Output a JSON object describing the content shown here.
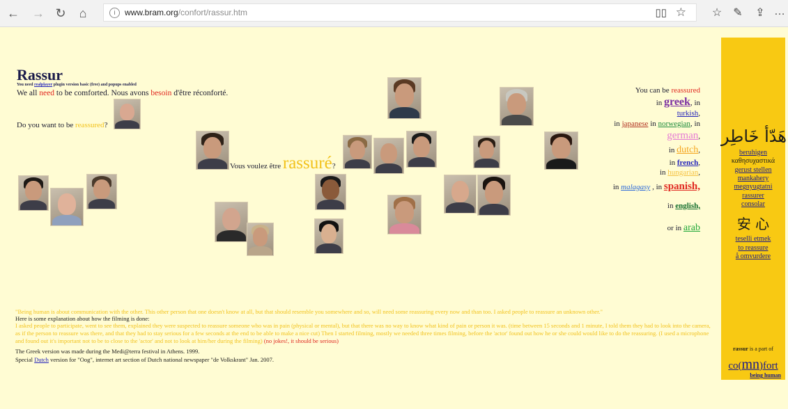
{
  "browser": {
    "url_host": "www.bram.org",
    "url_path": "/confort/rassur.htm"
  },
  "page": {
    "title": "Rassur",
    "plugin_note_pre": "You need ",
    "plugin_note_link": "realplayer",
    "plugin_note_post": " plugin version basic (free) and popups enabled",
    "tagline_1": "We all ",
    "tagline_need": "need",
    "tagline_2": " to be comforted. Nous avons ",
    "tagline_besoin": "besoin",
    "tagline_3": " d'être réconforté.",
    "want_pre": "Do you want to be ",
    "want_word": "reassured",
    "want_post": "?",
    "voulez_pre": "Vous voulez être ",
    "voulez_word": "rassuré",
    "voulez_post": "?",
    "right": {
      "line1_pre": "You can be ",
      "line1_word": "reassured",
      "in": "in ",
      "greek": "greek",
      "comma_in": ", in",
      "turkish": "turkish",
      "japanese": "japanese",
      "norwegian": "norwegian",
      "german": "german",
      "dutch": "dutch",
      "french": "french",
      "hungarian": "hungarian",
      "malagasy": "malagasy",
      "spanish": "spanish,",
      "english": "english,",
      "or_in": "or in ",
      "arab": "arab"
    },
    "sidebar": {
      "arabic": "هَدّأ خَاطِر",
      "berubigen": "beruhigen",
      "greek_word": "καθησυχαστικά",
      "gerust": "gerust stellen",
      "mankahery": "mankahery",
      "megnyugtatni": "megnyugtatni",
      "rassurer": "rassurer",
      "consolar": "consolar",
      "chinese": "安 心",
      "teselli": "teselli etmek",
      "to_reassure": "to reassure",
      "omvurdere": "å omvurdere",
      "part_of_bold": "rassur",
      "part_of": " is a part of",
      "comfort_a": "co(",
      "comfort_b": "mn",
      "comfort_c": ")fort",
      "being_human": "being human"
    },
    "bottom": {
      "quote": "\"Being human is about communication with the other. This other person that one doesn't know at all, but that should resemble you somewhere and so, will need some reassuring every now and than too. I asked people to reassure an unknown other.\"",
      "explain": "Here is some explanation about how the filming is done:",
      "process": "I asked people to participate, went to see them, explained they were suspected to reassure someone who was in pain (physical or mental), but that there was no way to know what kind of pain or person it was. (time between 15 seconds and 1 minute, I told them they had to look into the camera, as if the person to reassure was there, and that they had to stay serious for a few seconds at the end to be able to make a nice cut) Then I started filming, mostly we needed three times filming, before the 'actor' found out how he or she could would like to do the reassuring. (I used a microphone and found out it's important not to be to close to the 'actor' and not to look at him/her during the filming)",
      "nojokes": " (no jokes!, it should be serious)",
      "greek_version": "The Greek version was made during the Medi@terra festival in Athens. 1999.",
      "dutch_pre": "Special ",
      "dutch_link": "Dutch",
      "dutch_post": " version for \"Oog\", internet art section of Dutch national newspaper \"de Volkskrant\" Jan. 2007."
    }
  }
}
